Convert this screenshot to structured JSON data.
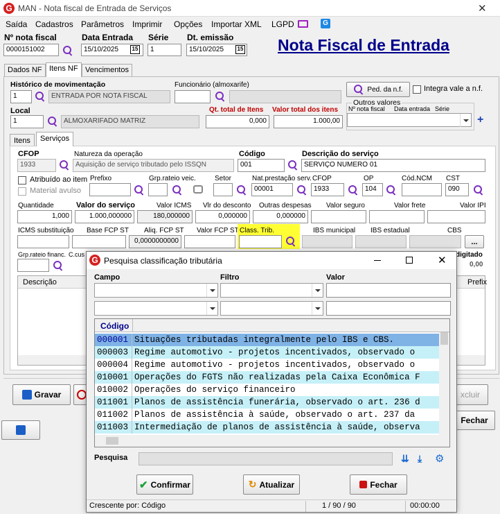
{
  "window": {
    "title": "MAN - Nota fiscal de Entrada de Serviços"
  },
  "menu": [
    "Saída",
    "Cadastros",
    "Parâmetros",
    "Imprimir",
    "Opções",
    "Importar XML",
    "LGPD"
  ],
  "header": {
    "nota_label": "Nº nota fiscal",
    "nota_value": "0000151002",
    "data_entrada_label": "Data Entrada",
    "data_entrada_value": "15/10/2025",
    "serie_label": "Série",
    "serie_value": "1",
    "emissao_label": "Dt. emissão",
    "emissao_value": "15/10/2025",
    "big_title": "Nota Fiscal de Entrada",
    "cal_icon": "15"
  },
  "tabs": [
    "Dados NF",
    "Itens NF",
    "Vencimentos"
  ],
  "itens": {
    "hist_label": "Histórico de movimentação",
    "hist_code": "1",
    "hist_desc": "ENTRADA POR NOTA FISCAL",
    "func_label": "Funcionário (almoxarife)",
    "ped_btn": "Ped. da n.f.",
    "integra_label": "Integra vale a n.f.",
    "local_label": "Local",
    "local_code": "1",
    "local_desc": "ALMOXARIFADO MATRIZ",
    "qt_total_label": "Qt. total de Itens",
    "qt_total_value": "0,000",
    "vl_total_label": "Valor total dos itens",
    "vl_total_value": "1.000,00",
    "outros_label": "Outros valores",
    "nf_label": "Nº nota fiscal",
    "de_label": "Data entrada",
    "serie_label": "Série"
  },
  "subtabs": [
    "Itens",
    "Serviços"
  ],
  "servicos": {
    "cfop_label": "CFOP",
    "cfop_value": "1933",
    "nat_label": "Natureza da operação",
    "nat_value": "Aquisição de serviço tributado pelo ISSQN",
    "codigo_label": "Código",
    "codigo_value": "001",
    "desc_label": "Descrição do serviço",
    "desc_value": "SERVIÇO NUMERO 01",
    "atrib_label": "Atribuído ao item",
    "material_label": "Material avulso",
    "prefixo_label": "Prefixo",
    "grp_veic_label": "Grp.rateio veic.",
    "setor_label": "Setor",
    "nat_prest_label": "Nat.prestação serv.",
    "nat_prest_value": "00001",
    "cfop2_label": "CFOP",
    "cfop2_value": "1933",
    "op_label": "OP",
    "op_value": "104",
    "ncm_label": "Cód.NCM",
    "cst_label": "CST",
    "cst_value": "090",
    "qtd_label": "Quantidade",
    "qtd_value": "1,000",
    "vls_label": "Valor do serviço",
    "vls_value": "1.000,000000",
    "icms_label": "Valor ICMS",
    "icms_value": "180,000000",
    "desc2_label": "Vlr do desconto",
    "desc2_value": "0,000000",
    "outras_label": "Outras despesas",
    "outras_value": "0,000000",
    "seguro_label": "Valor seguro",
    "frete_label": "Valor frete",
    "ipi_label": "Valor IPI",
    "icms_st_label": "ICMS substituição",
    "base_fcp_label": "Base FCP ST",
    "aliq_fcp_label": "Aliq. FCP ST",
    "aliq_fcp_value": "0,0000000000",
    "vfcp_label": "Valor FCP ST",
    "class_label": "Class. Trib.",
    "ibs_mun_label": "IBS municipal",
    "ibs_est_label": "IBS estadual",
    "cbs_label": "CBS",
    "grp_fin_label": "Grp.rateio financ.",
    "ccus_label": "C.cus",
    "digitado_label": "digitado",
    "digitado_value": "0,00",
    "list_desc_label": "Descrição",
    "list_prefix_label": "Prefix",
    "dots": "..."
  },
  "bottom": {
    "gravar": "Gravar",
    "excluir": "xcluir",
    "fechar": "Fechar"
  },
  "dialog": {
    "title": "Pesquisa classificação tributária",
    "campo_label": "Campo",
    "filtro_label": "Filtro",
    "valor_label": "Valor",
    "col_codigo": "Código",
    "rows": [
      {
        "code": "000001",
        "desc": "Situações tributadas integralmente pelo IBS e CBS."
      },
      {
        "code": "000003",
        "desc": "Regime automotivo - projetos incentivados, observado o"
      },
      {
        "code": "000004",
        "desc": "Regime automotivo - projetos incentivados, observado o"
      },
      {
        "code": "010001",
        "desc": "Operações do FGTS não realizadas pela Caixa Econômica F"
      },
      {
        "code": "010002",
        "desc": "Operações do serviço financeiro"
      },
      {
        "code": "011001",
        "desc": "Planos de assistência funerária, observado o art. 236 d"
      },
      {
        "code": "011002",
        "desc": "Planos de assistência à saúde, observado o art. 237 da"
      },
      {
        "code": "011003",
        "desc": "Intermediação de planos de assistência à saúde, observa"
      }
    ],
    "pesquisa_label": "Pesquisa",
    "confirmar": "Confirmar",
    "atualizar": "Atualizar",
    "fechar": "Fechar",
    "status_left": "Crescente por: Código",
    "status_mid": "1 / 90 / 90",
    "status_right": "00:00:00"
  },
  "colors": {
    "accent_purple": "#7b2fbe",
    "title_blue": "#00008b",
    "selected_row": "#7fb2e5",
    "alt_row": "#c6f0f8"
  }
}
